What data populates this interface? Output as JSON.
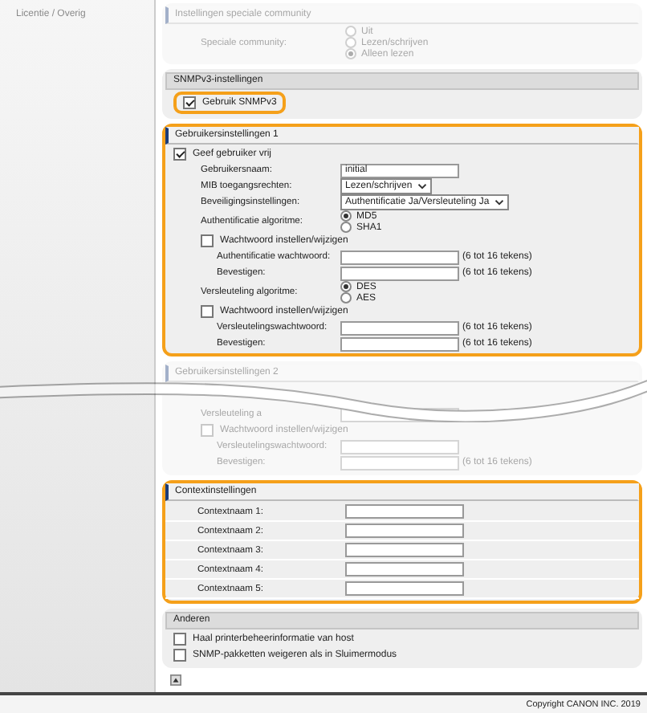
{
  "sidebar": {
    "items": [
      {
        "label": "Licentie / Overig",
        "disabled": true
      }
    ]
  },
  "community": {
    "title": "Instellingen speciale community",
    "disabled": true,
    "label": "Speciale community:",
    "options": [
      {
        "label": "Uit",
        "selected": false
      },
      {
        "label": "Lezen/schrijven",
        "selected": false
      },
      {
        "label": "Alleen lezen",
        "selected": true
      }
    ]
  },
  "snmpv3": {
    "title": "SNMPv3-instellingen",
    "checkbox": {
      "label": "Gebruik SNMPv3",
      "checked": true,
      "highlighted": true
    }
  },
  "user_settings_1": {
    "title": "Gebruikersinstellingen 1",
    "highlighted": true,
    "disabled": false,
    "rows": [
      {
        "kind": "checkbox",
        "label": "Geef gebruiker vrij",
        "checked": true,
        "children": [
          {
            "kind": "text",
            "label": "Gebruikersnaam:",
            "value": "initial"
          },
          {
            "kind": "select",
            "label": "MIB toegangsrechten:",
            "value": "Lezen/schrijven"
          },
          {
            "kind": "select",
            "label": "Beveiligingsinstellingen:",
            "value": "Authentificatie Ja/Versleuteling Ja"
          },
          {
            "kind": "radio",
            "label": "Authentificatie algoritme:",
            "options": [
              {
                "label": "MD5",
                "selected": true
              },
              {
                "label": "SHA1",
                "selected": false
              }
            ]
          },
          {
            "kind": "checkbox",
            "label": "Wachtwoord instellen/wijzigen",
            "checked": false,
            "children": [
              {
                "kind": "password",
                "label": "Authentificatie wachtwoord:",
                "hint": "(6 tot 16 tekens)"
              },
              {
                "kind": "password",
                "label": "Bevestigen:",
                "hint": "(6 tot 16 tekens)"
              }
            ]
          },
          {
            "kind": "radio",
            "label": "Versleuteling algoritme:",
            "options": [
              {
                "label": "DES",
                "selected": true
              },
              {
                "label": "AES",
                "selected": false
              }
            ]
          },
          {
            "kind": "checkbox",
            "label": "Wachtwoord instellen/wijzigen",
            "checked": false,
            "children": [
              {
                "kind": "password",
                "label": "Versleutelingswachtwoord:",
                "hint": "(6 tot 16 tekens)"
              },
              {
                "kind": "password",
                "label": "Bevestigen:",
                "hint": "(6 tot 16 tekens)"
              }
            ]
          }
        ]
      }
    ]
  },
  "user_settings_2": {
    "title": "Gebruikersinstellingen 2",
    "highlighted": false,
    "disabled": true,
    "rows": [
      {
        "kind": "password",
        "label": "Versleuteling a"
      },
      {
        "kind": "checkbox",
        "label": "Wachtwoord instellen/wijzigen",
        "checked": false,
        "children": [
          {
            "kind": "password",
            "label": "Versleutelingswachtwoord:"
          },
          {
            "kind": "password",
            "label": "Bevestigen:",
            "hint": "(6 tot 16 tekens)"
          }
        ]
      }
    ]
  },
  "context": {
    "title": "Contextinstellingen",
    "highlighted": true,
    "rows": [
      {
        "label": "Contextnaam 1:"
      },
      {
        "label": "Contextnaam 2:"
      },
      {
        "label": "Contextnaam 3:"
      },
      {
        "label": "Contextnaam 4:"
      },
      {
        "label": "Contextnaam 5:"
      }
    ]
  },
  "others": {
    "title": "Anderen",
    "checkboxes": [
      {
        "label": "Haal printerbeheerinformatie van host",
        "checked": false
      },
      {
        "label": "SNMP-pakketten weigeren als in Sluimermodus",
        "checked": false
      }
    ]
  },
  "footer": {
    "copyright": "Copyright CANON INC. 2019"
  }
}
